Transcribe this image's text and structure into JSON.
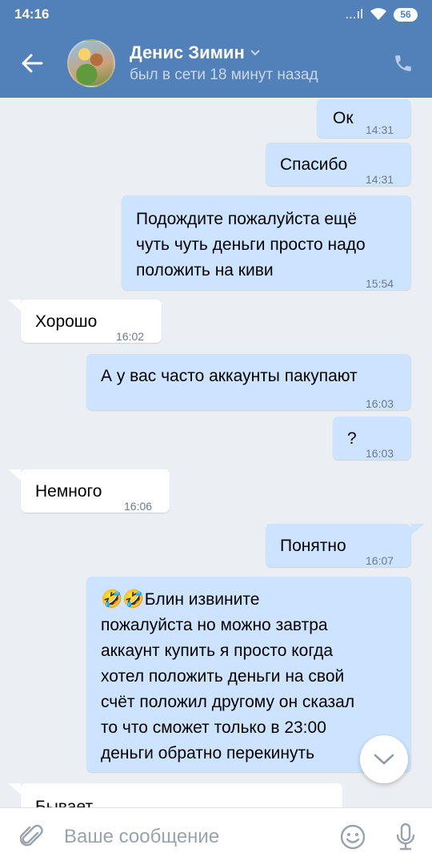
{
  "status_bar": {
    "time": "14:16",
    "signal": "...ıl",
    "battery": "56"
  },
  "header": {
    "name": "Денис Зимин",
    "status": "был в сети 18 минут назад"
  },
  "messages": [
    {
      "dir": "out",
      "text": "Ок",
      "time": "14:31"
    },
    {
      "dir": "out",
      "text": "Спасибо",
      "time": "14:31"
    },
    {
      "dir": "out",
      "text": "Подождите пожалуйста ещё\nчуть чуть деньги просто надо\nположить на киви",
      "time": "15:54"
    },
    {
      "dir": "in",
      "text": "Хорошо",
      "time": "16:02"
    },
    {
      "dir": "out",
      "text": "А у вас часто аккаунты пакупают",
      "time": "16:03"
    },
    {
      "dir": "out",
      "text": "?",
      "time": "16:03"
    },
    {
      "dir": "in",
      "text": "Немного",
      "time": "16:06"
    },
    {
      "dir": "out",
      "text": "Понятно",
      "time": "16:07"
    },
    {
      "dir": "out",
      "text": "Блин извините\nпожалуйста но можно завтра\nаккаунт купить я просто когда\nхотел положить деньги на свой\nсчёт положил другому он сказал\nто что сможет только в 23:00\nденьги обратно перекинуть",
      "time": "",
      "emoji_prefix": "🤣🤣"
    },
    {
      "dir": "in",
      "text": "Бывает",
      "time": ""
    }
  ],
  "input": {
    "placeholder": "Ваше сообщение",
    "value": ""
  }
}
